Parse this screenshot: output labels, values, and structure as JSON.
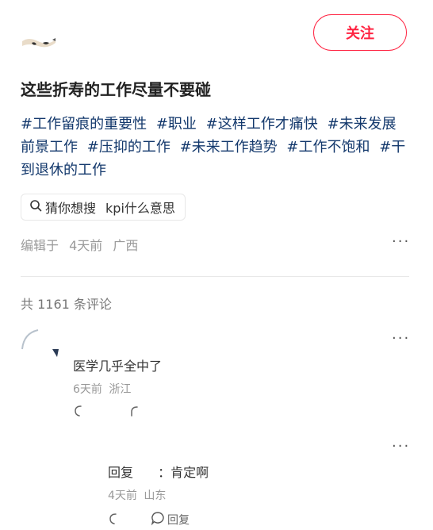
{
  "post": {
    "follow_label": "关注",
    "title": "这些折寿的工作尽量不要碰",
    "tags": [
      "#工作留痕的重要性",
      "#职业",
      "#这样工作才痛快",
      "#未来发展前景工作",
      "#压抑的工作",
      "#未来工作趋势",
      "#工作不饱和",
      "#干到退休的工作"
    ],
    "search_suggest": {
      "prefix": "猜你想搜",
      "query": "kpi什么意思"
    },
    "meta": {
      "edited_label": "编辑于",
      "time": "4天前",
      "location": "广西"
    },
    "more_label": "···"
  },
  "comments": {
    "count_label": "共 1161 条评论",
    "items": [
      {
        "text": "医学几乎全中了",
        "time": "6天前",
        "location": "浙江",
        "more_label": "···"
      }
    ],
    "reply": {
      "prefix": "回复",
      "text": "：肯定啊",
      "time": "4天前",
      "location": "山东",
      "reply_label": "回复",
      "more_label": "···"
    }
  }
}
